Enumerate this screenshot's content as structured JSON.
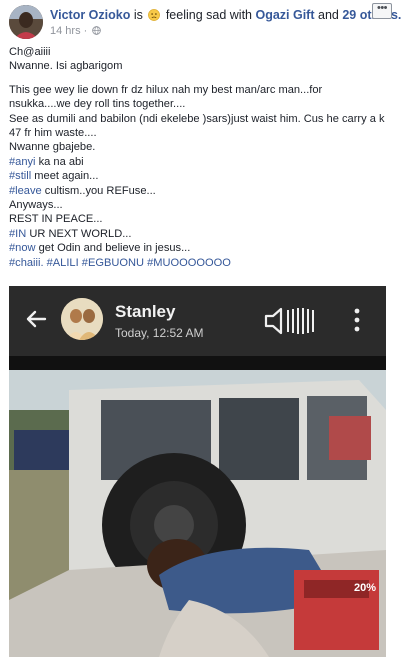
{
  "header": {
    "author": "Victor Ozioko",
    "feeling_prefix": "is",
    "feeling_text": "feeling sad with",
    "tagged_person": "Ogazi Gift",
    "and_text": "and",
    "others": "29 others.",
    "timestamp": "14 hrs",
    "separator": "·",
    "more_label": "•••"
  },
  "post": {
    "lines": [
      {
        "text": "Ch@aiiii"
      },
      {
        "text": "Nwanne. Isi agbarigom"
      },
      {
        "text": "This gee wey lie down fr dz hilux nah my best man/arc man...for"
      },
      {
        "text": "nsukka....we dey roll tins together...."
      },
      {
        "text": "See as dumili and babilon (ndi ekelebe )sars)just waist him. Cus he carry a k"
      },
      {
        "text": "47 fr him waste...."
      },
      {
        "text": "Nwanne gbajebe."
      },
      {
        "tag": "#anyi",
        "text": " ka na abi"
      },
      {
        "tag": "#still",
        "text": " meet again..."
      },
      {
        "tag": "#leave",
        "text": " cultism..you REFuse..."
      },
      {
        "text": "Anyways..."
      },
      {
        "text": "REST IN PEACE..."
      },
      {
        "tag": "#IN",
        "text": " UR NEXT WORLD..."
      },
      {
        "tag": "#now",
        "text": " get Odin and believe in jesus..."
      },
      {
        "tag": "#chaiii. #ALILI #EGBUONU #MUOOOOOOO",
        "text": ""
      }
    ]
  },
  "photo": {
    "contact_name": "Stanley",
    "contact_time": "Today, 12:52 AM",
    "zoom": "20%"
  },
  "colors": {
    "link": "#365899",
    "text": "#1d2129",
    "meta": "#90949c",
    "chat_header": "#2b2b2b"
  },
  "icons": {
    "emoji": "sad-face-icon",
    "privacy": "globe-icon",
    "back": "back-arrow-icon",
    "audio": "speaker-icon",
    "menu": "kebab-menu-icon"
  }
}
